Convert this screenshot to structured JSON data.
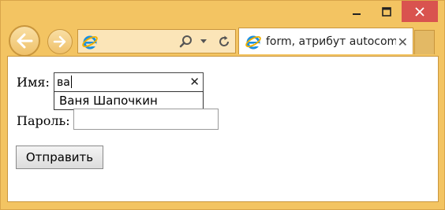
{
  "browser": {
    "tab_title": "form, атрибут autocom...",
    "tab_close_glyph": "✕",
    "accent_color": "#f1c15e",
    "close_button_color": "#d9534f"
  },
  "window_controls": {
    "minimize": "minimize-icon",
    "maximize": "maximize-icon",
    "close": "close-icon"
  },
  "form": {
    "name_label": "Имя:",
    "name_value": "ва",
    "clear_glyph": "✕",
    "suggestion": "Ваня Шапочкин",
    "password_label": "Пароль:",
    "password_value": "",
    "submit_label": "Отправить"
  }
}
